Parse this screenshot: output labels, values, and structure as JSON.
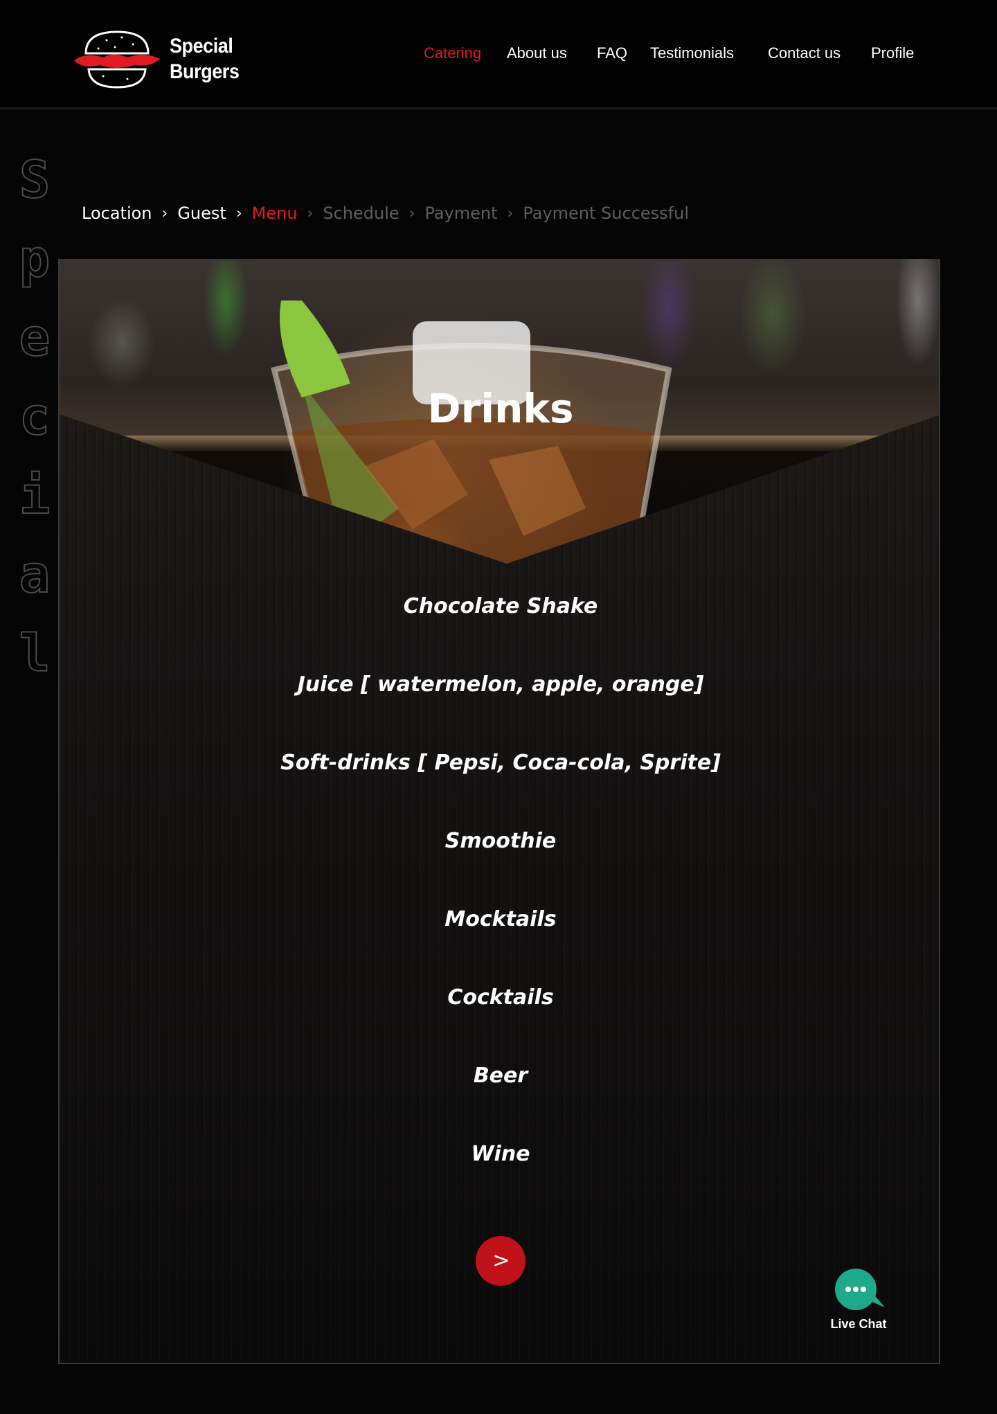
{
  "brand": {
    "line1": "Special",
    "line2": "Burgers"
  },
  "nav": {
    "items": [
      {
        "label": "Catering",
        "active": true
      },
      {
        "label": "About us"
      },
      {
        "label": "FAQ"
      },
      {
        "label": "Testimonials"
      },
      {
        "label": "Contact us"
      },
      {
        "label": "Profile"
      }
    ]
  },
  "side_word": [
    "S",
    "p",
    "e",
    "c",
    "i",
    "a",
    "l"
  ],
  "breadcrumb": [
    {
      "label": "Location",
      "state": "done"
    },
    {
      "label": "Guest",
      "state": "done"
    },
    {
      "label": "Menu",
      "state": "current"
    },
    {
      "label": "Schedule",
      "state": "todo"
    },
    {
      "label": "Payment",
      "state": "todo"
    },
    {
      "label": "Payment Successful",
      "state": "todo"
    }
  ],
  "section": {
    "title": "Drinks"
  },
  "drinks": [
    "Chocolate Shake",
    "Juice [ watermelon, apple, orange]",
    "Soft-drinks [ Pepsi, Coca-cola, Sprite]",
    "Smoothie",
    "Mocktails",
    "Cocktails",
    "Beer",
    "Wine"
  ],
  "next_button": {
    "icon": "chevron-right-icon",
    "glyph": ">"
  },
  "live_chat": {
    "label": "Live Chat",
    "icon": "chat-bubble-icon"
  },
  "colors": {
    "accent": "#e11b22",
    "button": "#c1121a",
    "chat": "#1fa98b",
    "background": "#050505"
  }
}
